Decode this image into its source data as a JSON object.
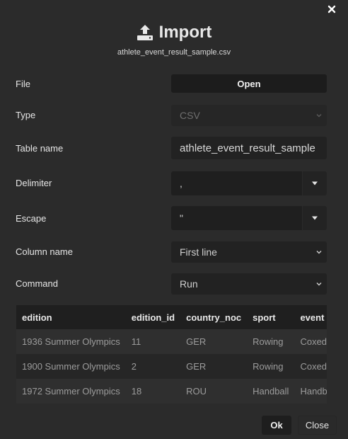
{
  "dialog": {
    "title": "Import",
    "filename": "athlete_event_result_sample.csv",
    "close_icon": "close-icon",
    "import_icon": "upload-icon"
  },
  "form": {
    "file_label": "File",
    "file_button": "Open",
    "type_label": "Type",
    "type_value": "CSV",
    "table_name_label": "Table name",
    "table_name_value": "athlete_event_result_sample",
    "delimiter_label": "Delimiter",
    "delimiter_value": ",",
    "escape_label": "Escape",
    "escape_value": "\"",
    "column_name_label": "Column name",
    "column_name_value": "First line",
    "command_label": "Command",
    "command_value": "Run"
  },
  "preview": {
    "columns": [
      "edition",
      "edition_id",
      "country_noc",
      "sport",
      "event"
    ],
    "rows": [
      [
        "1936 Summer Olympics",
        "11",
        "GER",
        "Rowing",
        "Coxed"
      ],
      [
        "1900 Summer Olympics",
        "2",
        "GER",
        "Rowing",
        "Coxed"
      ],
      [
        "1972 Summer Olympics",
        "18",
        "ROU",
        "Handball",
        "Handb"
      ]
    ]
  },
  "footer": {
    "ok_label": "Ok",
    "close_label": "Close"
  }
}
